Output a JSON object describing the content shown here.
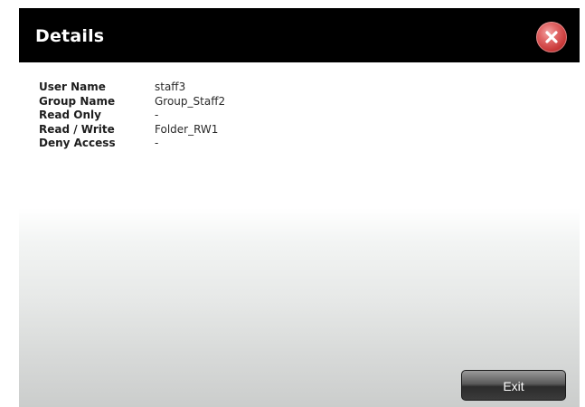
{
  "dialog": {
    "title": "Details",
    "close_icon": "close-x-circle-icon",
    "exit_label": "Exit"
  },
  "details": [
    {
      "label": "User Name",
      "value": "staff3"
    },
    {
      "label": "Group Name",
      "value": "Group_Staff2"
    },
    {
      "label": "Read Only",
      "value": "-"
    },
    {
      "label": "Read / Write",
      "value": "Folder_RW1"
    },
    {
      "label": "Deny Access",
      "value": "-"
    }
  ],
  "colors": {
    "titlebar": "#000000",
    "close_button": "#d24848",
    "exit_button": "#3b3b3b"
  }
}
